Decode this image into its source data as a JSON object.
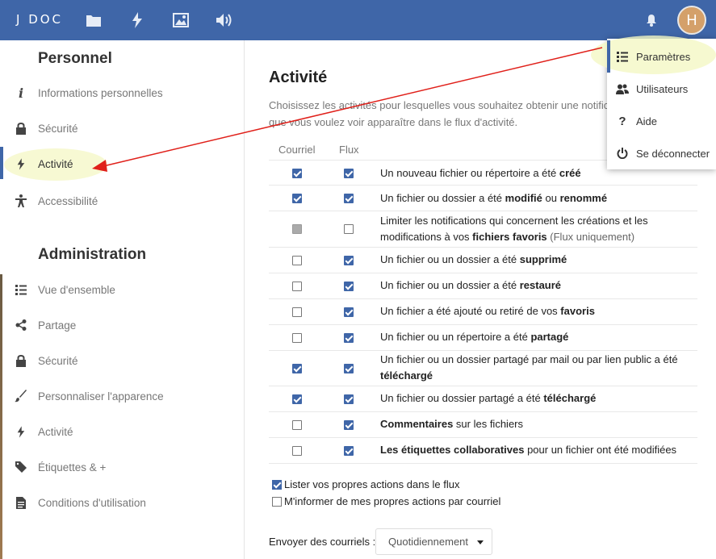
{
  "header": {
    "logo": "J DOC",
    "avatar_initial": "H"
  },
  "sidebar": {
    "personal_heading": "Personnel",
    "personal_items": [
      {
        "label": "Informations personnelles"
      },
      {
        "label": "Sécurité"
      },
      {
        "label": "Activité"
      },
      {
        "label": "Accessibilité"
      }
    ],
    "admin_heading": "Administration",
    "admin_items": [
      {
        "label": "Vue d'ensemble"
      },
      {
        "label": "Partage"
      },
      {
        "label": "Sécurité"
      },
      {
        "label": "Personnaliser l'apparence"
      },
      {
        "label": "Activité"
      },
      {
        "label": "Étiquettes & +"
      },
      {
        "label": "Conditions d'utilisation"
      }
    ]
  },
  "main": {
    "title": "Activité",
    "description_line1": "Choisissez les activités pour lesquelles vous souhaitez obtenir une notifica",
    "description_line2": "que vous voulez voir apparaître dans le flux d'activité.",
    "col_email": "Courriel",
    "col_stream": "Flux",
    "rows": [
      {
        "t1": "Un nouveau fichier ou répertoire a été ",
        "b1": "créé"
      },
      {
        "t1": "Un fichier ou dossier a été ",
        "b1": "modifié",
        "t2": " ou ",
        "b2": "renommé"
      },
      {
        "t1": "Limiter les notifications qui concernent les créations et les modifications à vos ",
        "b1": "fichiers favoris",
        "m": " (Flux uniquement)"
      },
      {
        "t1": "Un fichier ou un dossier a été ",
        "b1": "supprimé"
      },
      {
        "t1": "Un fichier ou un dossier a été ",
        "b1": "restauré"
      },
      {
        "t1": "Un fichier a été ajouté ou retiré de vos ",
        "b1": "favoris"
      },
      {
        "t1": "Un fichier ou un répertoire a été ",
        "b1": "partagé"
      },
      {
        "t1": "Un fichier ou un dossier partagé par mail ou par lien public a été ",
        "b1": "téléchargé"
      },
      {
        "t1": "Un fichier ou dossier partagé a été ",
        "b1": "téléchargé"
      },
      {
        "b0": "Commentaires",
        "t1": " sur les fichiers"
      },
      {
        "b0": "Les étiquettes collaboratives",
        "t1": " pour un fichier ont été modifiées"
      }
    ],
    "opt_list_own": "Lister vos propres actions dans le flux",
    "opt_notify_own": "M'informer de mes propres actions par courriel",
    "frequency_label": "Envoyer des courriels :",
    "frequency_value": "Quotidiennement"
  },
  "menu": {
    "items": [
      {
        "label": "Paramètres"
      },
      {
        "label": "Utilisateurs"
      },
      {
        "label": "Aide"
      },
      {
        "label": "Se déconnecter"
      }
    ]
  },
  "colors": {
    "header": "#3f66a8",
    "checkbox": "#3f66a8",
    "annotation_arrow": "#e0201a",
    "highlight": "#f4f7c4"
  }
}
